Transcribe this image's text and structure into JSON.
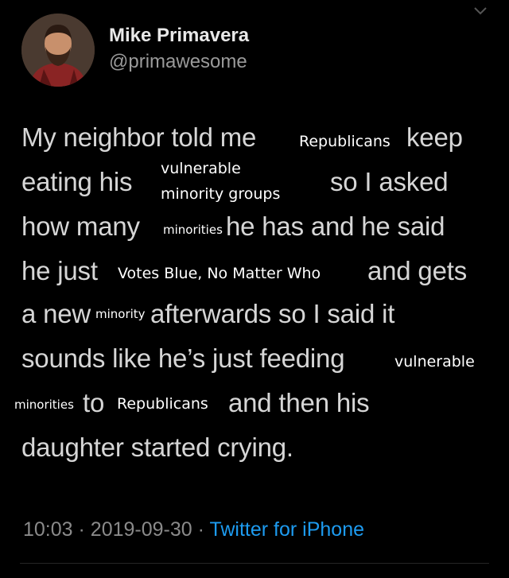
{
  "tweet": {
    "author": {
      "name": "Mike Primavera",
      "handle": "@primawesome",
      "avatar_icon": "profile-photo"
    },
    "menu_icon": "chevron-down-icon",
    "text_lines": [
      "My neighbor told me",
      "keep",
      "eating his",
      "so I asked",
      "how many",
      "he has and he said",
      "he just",
      "and gets",
      "a new",
      "afterwards so I said it",
      "sounds like he’s just feeding",
      "to",
      "and then his",
      "daughter started crying."
    ],
    "edits": [
      "Republicans",
      "vulnerable",
      "minority groups",
      "minorities",
      "Votes Blue, No Matter Who",
      "minority",
      "vulnerable",
      "minorities",
      "Republicans"
    ],
    "meta": {
      "time": "10:03",
      "separator": "·",
      "date": "2019-09-30",
      "source": "Twitter for iPhone"
    }
  }
}
